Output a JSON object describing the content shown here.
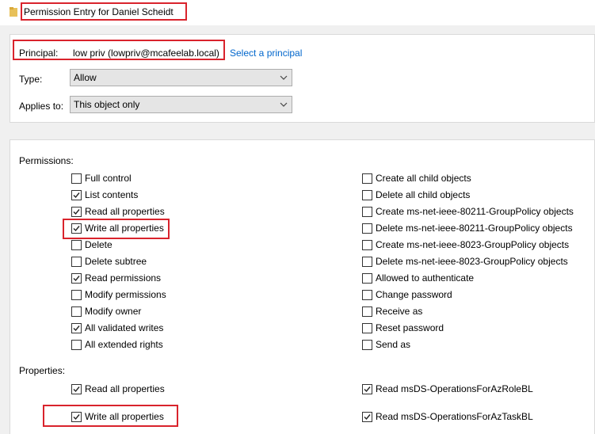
{
  "title": "Permission Entry for Daniel Scheidt",
  "principal": {
    "label": "Principal:",
    "value": "low priv (lowpriv@mcafeelab.local)",
    "select_link": "Select a principal"
  },
  "type": {
    "label": "Type:",
    "value": "Allow"
  },
  "applies_to": {
    "label": "Applies to:",
    "value": "This object only"
  },
  "permissions": {
    "heading": "Permissions:",
    "left": [
      {
        "label": "Full control",
        "checked": false
      },
      {
        "label": "List contents",
        "checked": true
      },
      {
        "label": "Read all properties",
        "checked": true
      },
      {
        "label": "Write all properties",
        "checked": true
      },
      {
        "label": "Delete",
        "checked": false
      },
      {
        "label": "Delete subtree",
        "checked": false
      },
      {
        "label": "Read permissions",
        "checked": true
      },
      {
        "label": "Modify permissions",
        "checked": false
      },
      {
        "label": "Modify owner",
        "checked": false
      },
      {
        "label": "All validated writes",
        "checked": true
      },
      {
        "label": "All extended rights",
        "checked": false
      }
    ],
    "right": [
      {
        "label": "Create all child objects",
        "checked": false
      },
      {
        "label": "Delete all child objects",
        "checked": false
      },
      {
        "label": "Create ms-net-ieee-80211-GroupPolicy objects",
        "checked": false
      },
      {
        "label": "Delete ms-net-ieee-80211-GroupPolicy objects",
        "checked": false
      },
      {
        "label": "Create ms-net-ieee-8023-GroupPolicy objects",
        "checked": false
      },
      {
        "label": "Delete ms-net-ieee-8023-GroupPolicy objects",
        "checked": false
      },
      {
        "label": "Allowed to authenticate",
        "checked": false
      },
      {
        "label": "Change password",
        "checked": false
      },
      {
        "label": "Receive as",
        "checked": false
      },
      {
        "label": "Reset password",
        "checked": false
      },
      {
        "label": "Send as",
        "checked": false
      }
    ]
  },
  "properties": {
    "heading": "Properties:",
    "left": [
      {
        "label": "Read all properties",
        "checked": true
      },
      {
        "label": "Write all properties",
        "checked": true
      }
    ],
    "right": [
      {
        "label": "Read msDS-OperationsForAzRoleBL",
        "checked": true
      },
      {
        "label": "Read msDS-OperationsForAzTaskBL",
        "checked": true
      }
    ]
  },
  "colors": {
    "highlight": "#d9232c",
    "link": "#0066cc",
    "pane": "#f0f0f0"
  },
  "icons": {
    "title": "folder-icon",
    "dropdown": "chevron-down-icon",
    "check": "checkmark-icon"
  }
}
